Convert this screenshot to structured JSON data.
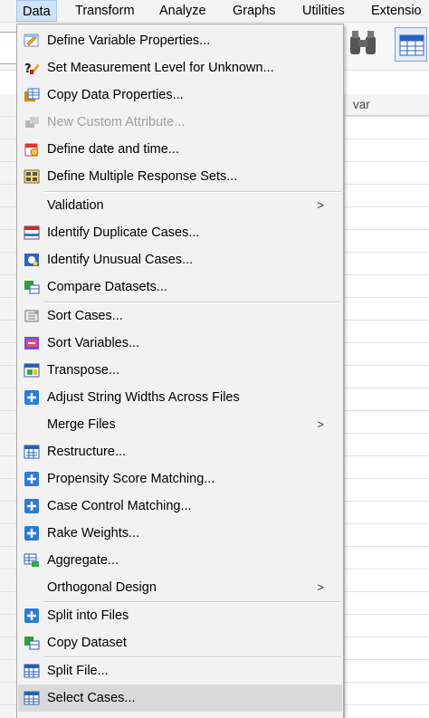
{
  "menubar": {
    "items": [
      {
        "label": "Data",
        "active": true
      },
      {
        "label": "Transform"
      },
      {
        "label": "Analyze"
      },
      {
        "label": "Graphs"
      },
      {
        "label": "Utilities"
      },
      {
        "label": "Extensio"
      }
    ]
  },
  "grid": {
    "column_header": "var"
  },
  "menu": {
    "items": [
      {
        "label": "Define Variable Properties...",
        "icon": "define-variable-properties-icon"
      },
      {
        "label": "Set Measurement Level for Unknown...",
        "icon": "measurement-level-icon"
      },
      {
        "label": "Copy Data Properties...",
        "icon": "copy-data-properties-icon"
      },
      {
        "label": "New Custom Attribute...",
        "icon": "custom-attribute-icon",
        "disabled": true
      },
      {
        "label": "Define date and time...",
        "icon": "calendar-icon"
      },
      {
        "label": "Define Multiple Response Sets...",
        "icon": "response-sets-icon"
      },
      {
        "label": "Validation",
        "submenu": true
      },
      {
        "label": "Identify Duplicate Cases...",
        "icon": "duplicate-cases-icon"
      },
      {
        "label": "Identify Unusual Cases...",
        "icon": "unusual-cases-icon"
      },
      {
        "label": "Compare Datasets...",
        "icon": "compare-datasets-icon"
      },
      {
        "label": "Sort Cases...",
        "icon": "sort-cases-icon"
      },
      {
        "label": "Sort Variables...",
        "icon": "sort-variables-icon"
      },
      {
        "label": "Transpose...",
        "icon": "transpose-icon"
      },
      {
        "label": "Adjust String Widths Across Files",
        "icon": "plus-icon"
      },
      {
        "label": "Merge Files",
        "submenu": true
      },
      {
        "label": "Restructure...",
        "icon": "restructure-icon"
      },
      {
        "label": "Propensity Score Matching...",
        "icon": "plus-icon"
      },
      {
        "label": "Case Control Matching...",
        "icon": "plus-icon"
      },
      {
        "label": "Rake Weights...",
        "icon": "plus-icon"
      },
      {
        "label": "Aggregate...",
        "icon": "aggregate-icon"
      },
      {
        "label": "Orthogonal Design",
        "submenu": true
      },
      {
        "label": "Split into Files",
        "icon": "plus-icon"
      },
      {
        "label": "Copy Dataset",
        "icon": "copy-dataset-icon"
      },
      {
        "label": "Split File...",
        "icon": "split-file-icon"
      },
      {
        "label": "Select Cases...",
        "icon": "select-cases-icon",
        "highlighted": true
      }
    ],
    "submenu_arrow": ">"
  },
  "colors": {
    "menu_bg": "#f2f2f2",
    "highlight": "#d9d9d9",
    "active_menubar": "#cfe2f7",
    "icon_blue": "#2f7bd6"
  }
}
